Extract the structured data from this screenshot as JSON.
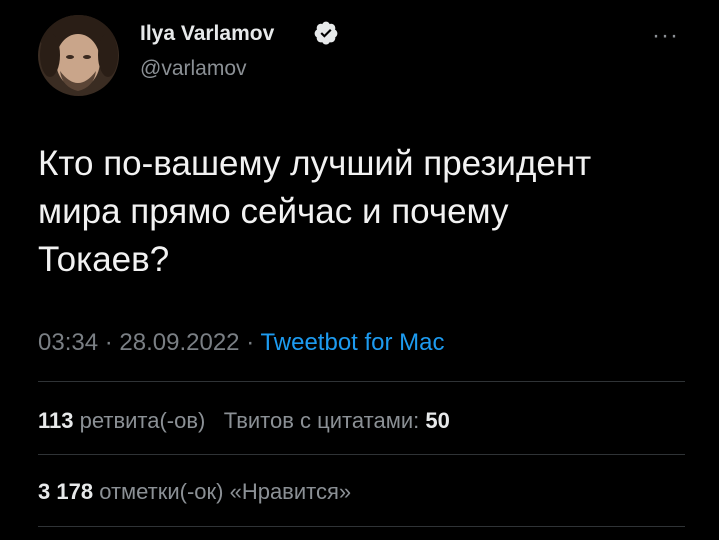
{
  "tweet": {
    "author_name": "Ilya Varlamov",
    "handle": "@varlamov",
    "more_icon": "more-icon",
    "text_lines": [
      "Кто по-вашему лучший президент",
      "мира прямо сейчас и почему",
      "Токаев?"
    ],
    "time": "03:34",
    "date": "28.09.2022",
    "separator": "·",
    "source": "Tweetbot for Mac"
  },
  "stats": {
    "retweets_count": "113",
    "retweets_label": "ретвита(-ов)",
    "quotes_label": "Твитов с цитатами:",
    "quotes_count": "50",
    "likes_count": "3 178",
    "likes_label": "отметки(-ок) «Нравится»"
  },
  "colors": {
    "background": "#000000",
    "text": "#e7e9ea",
    "secondary": "#8b9095",
    "link": "#1d9bf0",
    "verified": "#e7e9ea"
  }
}
